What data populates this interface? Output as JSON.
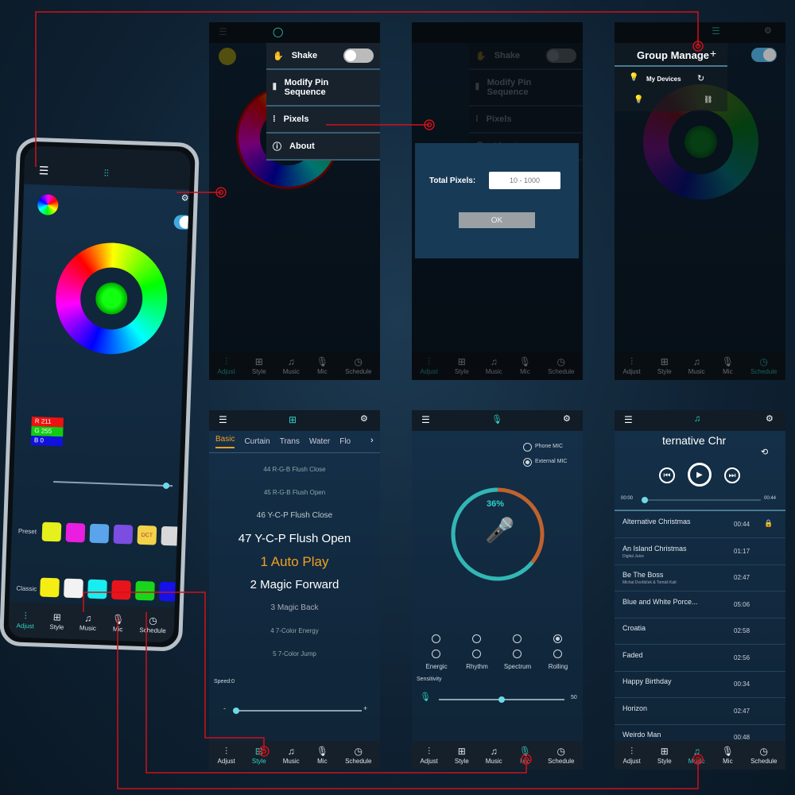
{
  "colors": {
    "accent": "#2fd3c7",
    "connector": "#d0101a",
    "mic_ring_active": "#2fb8b8",
    "mic_ring_rest": "#c0622e"
  },
  "nav_tabs": [
    {
      "label": "Adjust",
      "icon": "sliders-icon"
    },
    {
      "label": "Style",
      "icon": "grid-icon"
    },
    {
      "label": "Music",
      "icon": "music-note-icon"
    },
    {
      "label": "Mic",
      "icon": "microphone-icon"
    },
    {
      "label": "Schedule",
      "icon": "clock-icon"
    }
  ],
  "adjust": {
    "rgb": {
      "r_label": "R",
      "r": "211",
      "g_label": "G",
      "g": "255",
      "b_label": "B",
      "b": "0"
    },
    "brightness_percent": 97,
    "preset_label": "Preset",
    "classic_label": "Classic",
    "preset_colors": [
      "#e6f01c",
      "#e91ee0",
      "#5aa4ec",
      "#7b4de0",
      "#f2d24a",
      "#d8d8d8"
    ],
    "preset_badge": "DCT",
    "classic_colors": [
      "#f5ee14",
      "#f2f2f2",
      "#18eef0",
      "#e8141c",
      "#18d61c",
      "#1412e8"
    ],
    "power_on": true
  },
  "side_menu": {
    "items": [
      {
        "label": "Shake",
        "icon": "shake-icon",
        "toggle": true
      },
      {
        "label": "Modify Pin Sequence",
        "icon": "pin-icon"
      },
      {
        "label": "Pixels",
        "icon": "pixels-icon"
      },
      {
        "label": "About",
        "icon": "info-icon"
      }
    ]
  },
  "pixels_dialog": {
    "label": "Total Pixels:",
    "placeholder": "10 - 1000",
    "ok": "OK"
  },
  "group": {
    "title": "Group Manage",
    "add": "+",
    "my_devices": "My Devices"
  },
  "style": {
    "tabs": [
      "Basic",
      "Curtain",
      "Trans",
      "Water",
      "Flo"
    ],
    "active_tab": "Basic",
    "items": [
      "44 R-G-B Flush Close",
      "45 R-G-B Flush Open",
      "46 Y-C-P Flush Close",
      "47 Y-C-P Flush Open",
      "1 Auto Play",
      "2 Magic Forward",
      "3 Magic Back",
      "4 7-Color Energy",
      "5 7-Color Jump"
    ],
    "selected": "1 Auto Play",
    "speed_label": "Speed:0",
    "minus": "-",
    "plus": "+"
  },
  "mic": {
    "sources": [
      {
        "label": "Phone MIC",
        "selected": false
      },
      {
        "label": "External MIC",
        "selected": true
      }
    ],
    "level": "36%",
    "level_value": 36,
    "modes": [
      "Energic",
      "Rhythm",
      "Spectrum",
      "Rolling"
    ],
    "selected_mode": "Rolling",
    "sensitivity_label": "Sensitivity",
    "sensitivity": "50",
    "sensitivity_value": 50
  },
  "music": {
    "now_playing": "ternative Chr",
    "elapsed": "00:00",
    "total": "00:44",
    "songs": [
      {
        "title": "Alternative Christmas",
        "artist": "",
        "duration": "00:44"
      },
      {
        "title": "An Island Christmas",
        "artist": "Digital Juice",
        "duration": "01:17"
      },
      {
        "title": "Be The Boss",
        "artist": "Michal Dvořáček & Tomáš Kalt",
        "duration": "02:47"
      },
      {
        "title": "Blue and White Porce...",
        "artist": "",
        "duration": "05:06"
      },
      {
        "title": "Croatia",
        "artist": "",
        "duration": "02:58"
      },
      {
        "title": "Faded",
        "artist": "",
        "duration": "02:56"
      },
      {
        "title": "Happy Birthday",
        "artist": "",
        "duration": "00:34"
      },
      {
        "title": "Horizon",
        "artist": "",
        "duration": "02:47"
      },
      {
        "title": "Weirdo Man",
        "artist": "",
        "duration": "00:48"
      }
    ]
  }
}
